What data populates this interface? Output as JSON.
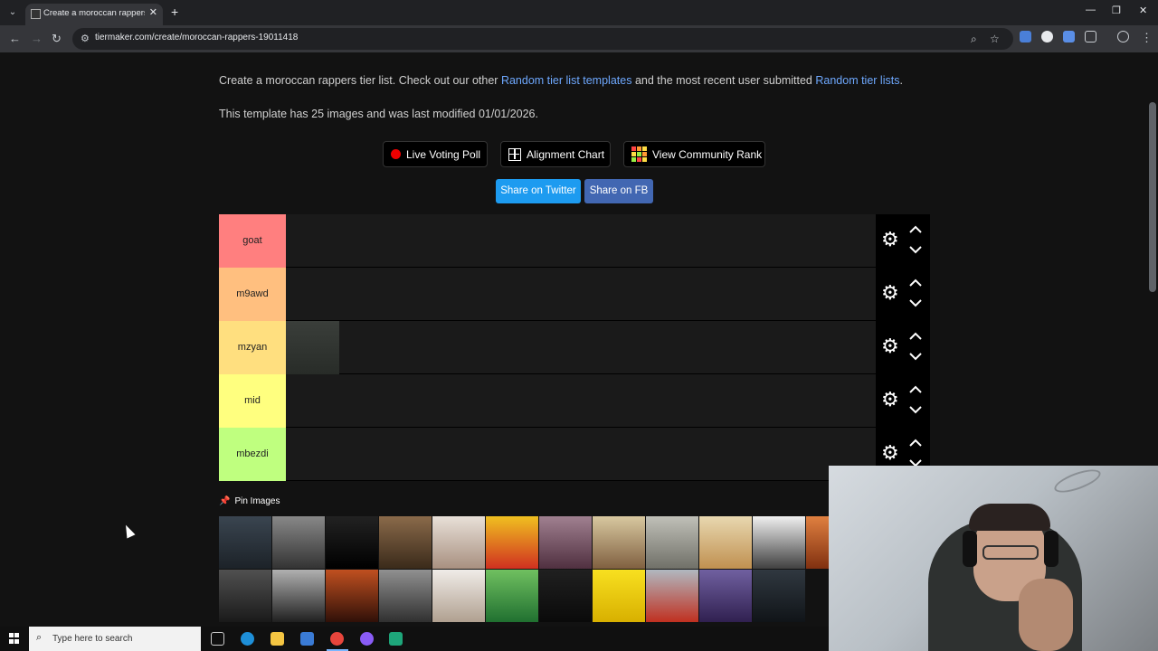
{
  "browser": {
    "tab_title": "Create a moroccan rappers Tier",
    "url": "tiermaker.com/create/moroccan-rappers-19011418",
    "tab_close": "✕",
    "new_tab": "+"
  },
  "page": {
    "description_prefix": "Create a moroccan rappers tier list. Check out our other ",
    "link1": "Random tier list templates",
    "description_mid": " and the most recent user submitted ",
    "link2": "Random tier lists",
    "description_suffix": ".",
    "meta": "This template has 25 images and was last modified 01/01/2026.",
    "buttons": {
      "live_poll": "Live Voting Poll",
      "alignment": "Alignment Chart",
      "community": "View Community Rank",
      "share_twitter": "Share on Twitter",
      "share_fb": "Share on FB"
    },
    "tiers": [
      {
        "label": "goat",
        "color": "#ff7f7f"
      },
      {
        "label": "m9awd",
        "color": "#ffbf7f"
      },
      {
        "label": "mzyan",
        "color": "#ffdf7f"
      },
      {
        "label": "mid",
        "color": "#ffff7f"
      },
      {
        "label": "mbezdi",
        "color": "#bfff7f"
      }
    ],
    "pin_images": "Pin Images"
  },
  "taskbar": {
    "search_placeholder": "Type here to search"
  },
  "colors": {
    "twitter": "#1d9bf0",
    "facebook": "#4267b2",
    "link": "#6ea8fe"
  }
}
